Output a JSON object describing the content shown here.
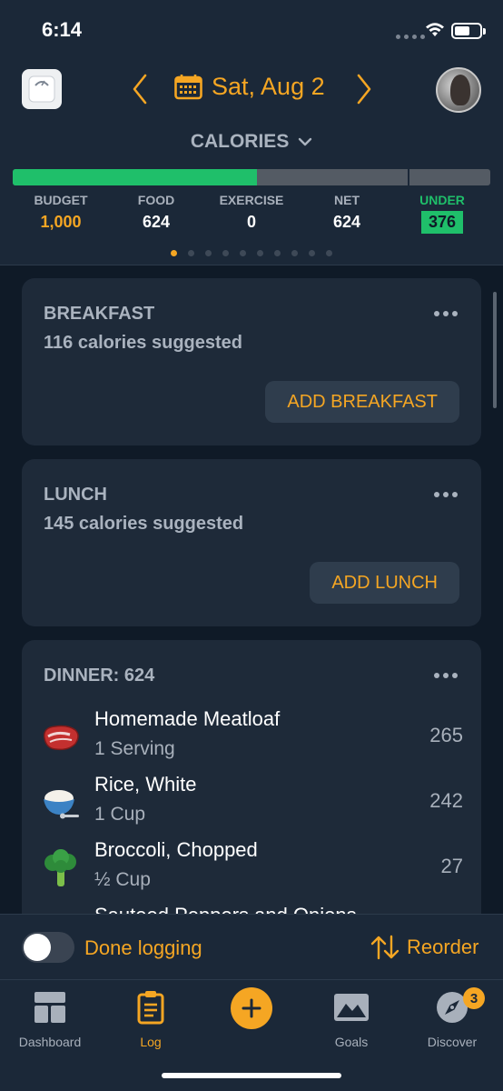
{
  "status": {
    "time": "6:14"
  },
  "header": {
    "date": "Sat, Aug 2",
    "section": "CALORIES",
    "progress": 0.624,
    "stats": [
      {
        "label": "BUDGET",
        "value": "1,000"
      },
      {
        "label": "FOOD",
        "value": "624"
      },
      {
        "label": "EXERCISE",
        "value": "0"
      },
      {
        "label": "NET",
        "value": "624"
      },
      {
        "label": "UNDER",
        "value": "376"
      }
    ],
    "page_count": 10,
    "active_page": 0
  },
  "meals": {
    "breakfast": {
      "title": "BREAKFAST",
      "suggested": "116 calories suggested",
      "add_label": "ADD BREAKFAST"
    },
    "lunch": {
      "title": "LUNCH",
      "suggested": "145 calories suggested",
      "add_label": "ADD LUNCH"
    },
    "dinner": {
      "title": "DINNER: 624",
      "items": [
        {
          "name": "Homemade Meatloaf",
          "qty": "1 Serving",
          "cals": "265",
          "icon": "steak-icon"
        },
        {
          "name": "Rice, White",
          "qty": "1 Cup",
          "cals": "242",
          "icon": "rice-bowl-icon"
        },
        {
          "name": "Broccoli, Chopped",
          "qty": "½ Cup",
          "cals": "27",
          "icon": "broccoli-icon"
        },
        {
          "name": "Sauteed Peppers and Onions",
          "qty": "",
          "cals": "",
          "icon": "peppers-icon"
        }
      ]
    }
  },
  "footer": {
    "done_label": "Done logging",
    "done_on": false,
    "reorder_label": "Reorder"
  },
  "tabs": [
    {
      "label": "Dashboard",
      "icon": "dashboard-icon"
    },
    {
      "label": "Log",
      "icon": "clipboard-icon"
    },
    {
      "label": "",
      "icon": "plus-icon"
    },
    {
      "label": "Goals",
      "icon": "goals-icon"
    },
    {
      "label": "Discover",
      "icon": "compass-icon",
      "badge": "3"
    }
  ],
  "colors": {
    "accent": "#f5a623",
    "green": "#1fbf6a",
    "background": "#0f1a27",
    "card": "#1e2a39"
  }
}
